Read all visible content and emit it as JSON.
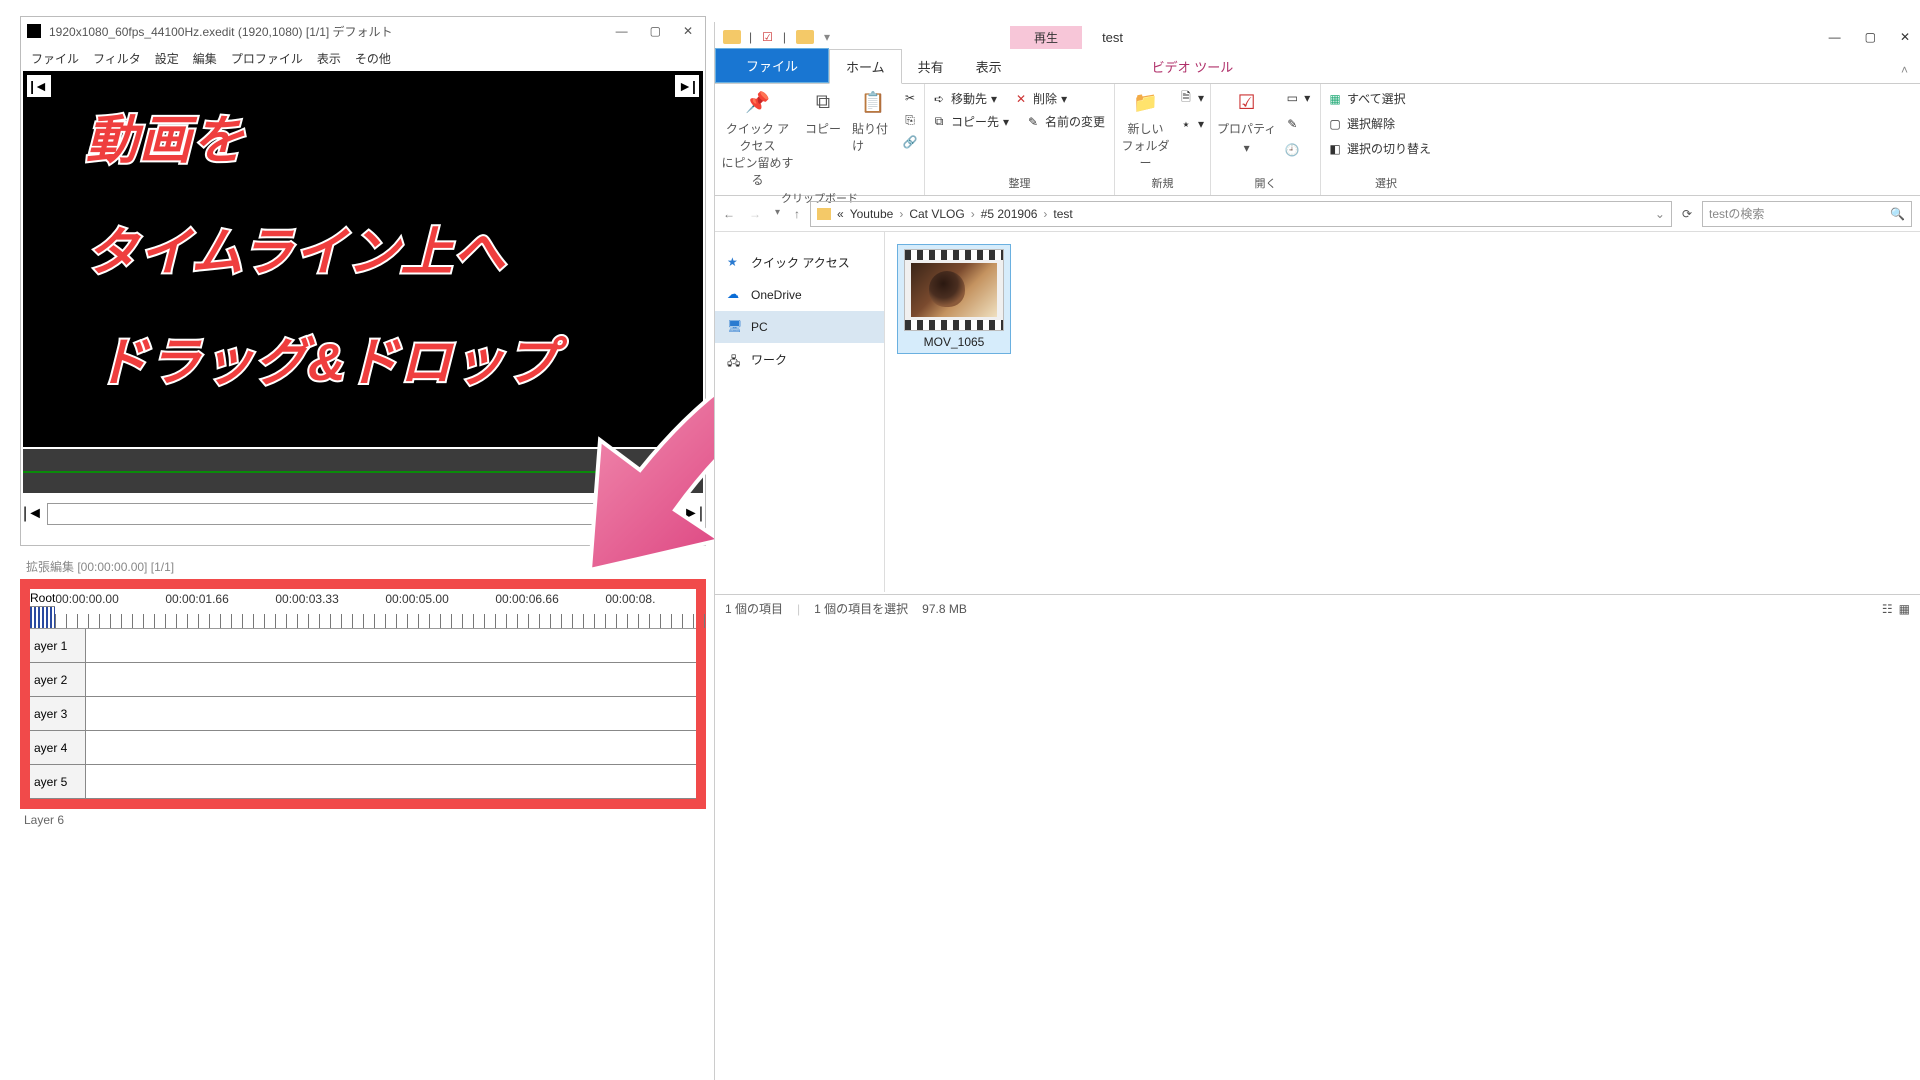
{
  "aviutl": {
    "title": "1920x1080_60fps_44100Hz.exedit (1920,1080) [1/1] デフォルト",
    "menu": [
      "ファイル",
      "フィルタ",
      "設定",
      "編集",
      "プロファイル",
      "表示",
      "その他"
    ]
  },
  "overlay": {
    "l1": "動画を",
    "l2": "タイムライン上へ",
    "l3": "ドラッグ&ドロップ"
  },
  "timeline": {
    "title": "拡張編集 [00:00:00.00] [1/1]",
    "root": "Root",
    "times": [
      "00:00:00.00",
      "00:00:01.66",
      "00:00:03.33",
      "00:00:05.00",
      "00:00:06.66",
      "00:00:08."
    ],
    "layers": [
      "ayer 1",
      "ayer 2",
      "ayer 3",
      "ayer 4",
      "ayer 5"
    ],
    "layer6": "Layer 6"
  },
  "explorer": {
    "play_tab": "再生",
    "window_title": "test",
    "tabs": {
      "file": "ファイル",
      "home": "ホーム",
      "share": "共有",
      "view": "表示",
      "video": "ビデオ ツール"
    },
    "ribbon": {
      "pin": "クイック アクセス\nにピン留めする",
      "copy": "コピー",
      "paste": "貼り付け",
      "cut": "",
      "copypath": "",
      "shortcut": "",
      "moveTo": "移動先",
      "copyTo": "コピー先",
      "delete": "削除",
      "rename": "名前の変更",
      "newFolder": "新しい\nフォルダー",
      "newItem": "",
      "easy": "",
      "properties": "プロパティ",
      "open": "",
      "edit": "",
      "history": "",
      "selectAll": "すべて選択",
      "selectNone": "選択解除",
      "invert": "選択の切り替え",
      "g_clipboard": "クリップボード",
      "g_organize": "整理",
      "g_new": "新規",
      "g_open": "開く",
      "g_select": "選択"
    },
    "path": {
      "prefix": "«",
      "p1": "Youtube",
      "p2": "Cat VLOG",
      "p3": "#5 201906",
      "p4": "test"
    },
    "search_placeholder": "testの検索",
    "nav": {
      "quick": "クイック アクセス",
      "onedrive": "OneDrive",
      "pc": "PC",
      "network": "ワーク"
    },
    "file": {
      "name": "MOV_1065"
    },
    "status": {
      "count": "1 個の項目",
      "sel": "1 個の項目を選択",
      "size": "97.8 MB"
    }
  }
}
